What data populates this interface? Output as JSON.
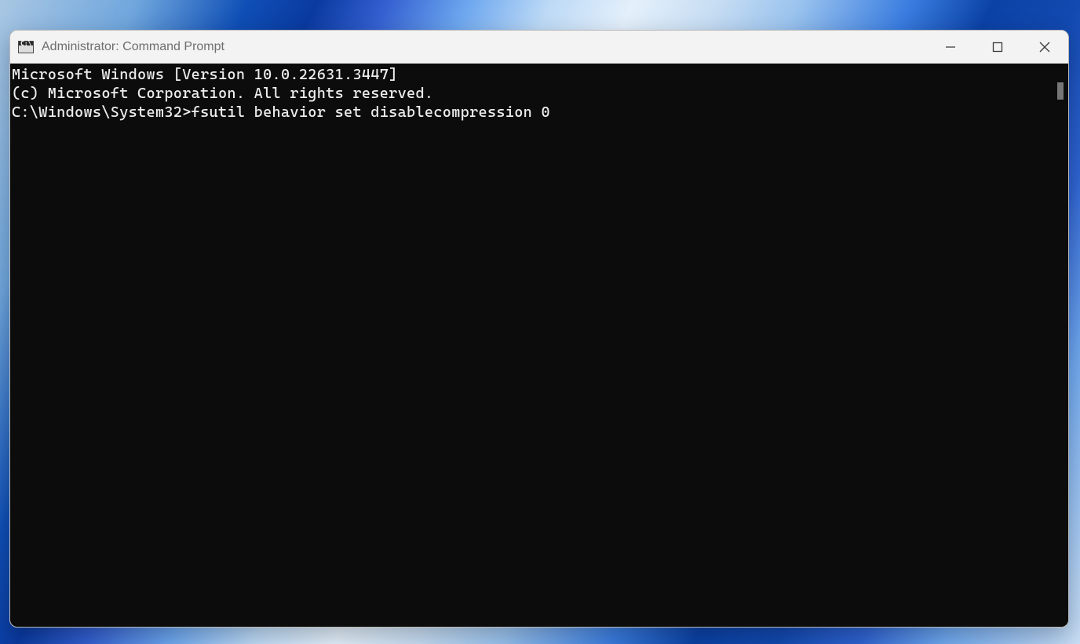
{
  "window": {
    "title": "Administrator: Command Prompt",
    "icon_label": "C:\\"
  },
  "terminal": {
    "banner_line1": "Microsoft Windows [Version 10.0.22631.3447]",
    "banner_line2": "(c) Microsoft Corporation. All rights reserved.",
    "blank": "",
    "prompt_path": "C:\\Windows\\System32>",
    "command": "fsutil behavior set disablecompression 0"
  }
}
